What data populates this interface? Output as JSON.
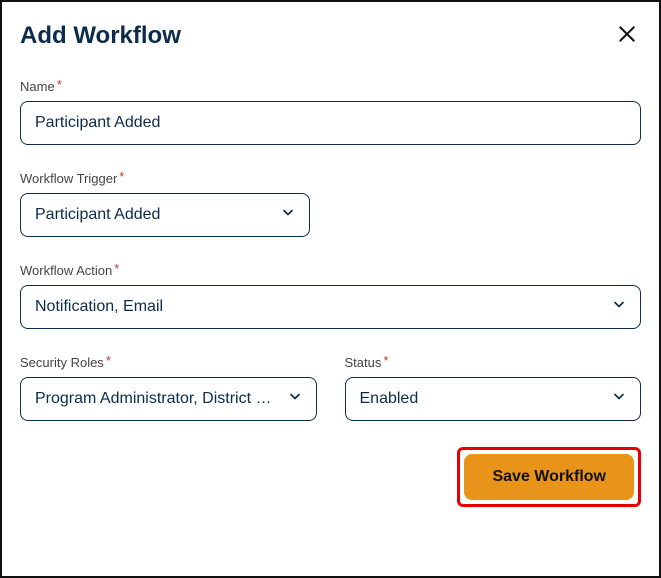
{
  "dialog": {
    "title": "Add Workflow"
  },
  "fields": {
    "name": {
      "label": "Name",
      "value": "Participant Added"
    },
    "trigger": {
      "label": "Workflow Trigger",
      "value": "Participant Added"
    },
    "action": {
      "label": "Workflow Action",
      "value": "Notification, Email"
    },
    "roles": {
      "label": "Security Roles",
      "value": "Program Administrator, District …"
    },
    "status": {
      "label": "Status",
      "value": "Enabled"
    }
  },
  "buttons": {
    "save": "Save Workflow"
  },
  "required_marker": "*"
}
